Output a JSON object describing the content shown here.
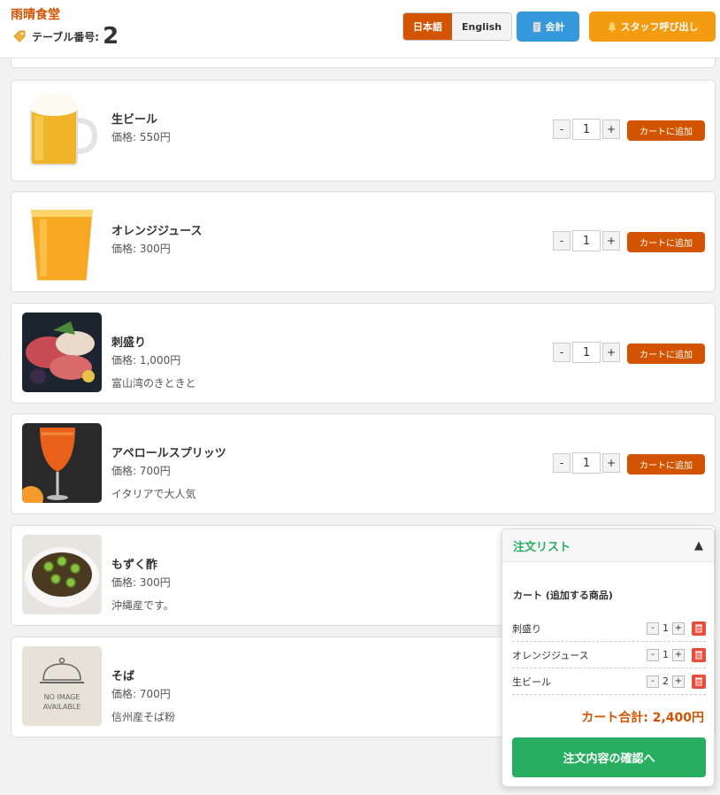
{
  "header": {
    "store_name": "雨晴食堂",
    "table_label": "テーブル番号:",
    "table_number": "2",
    "lang_ja": "日本語",
    "lang_en": "English",
    "pay_label": "会計",
    "staff_label": "スタッフ呼び出し"
  },
  "items": [
    {
      "name": "生ビール",
      "price": "価格: 550円",
      "desc": "",
      "qty": "1",
      "add_label": "カートに追加"
    },
    {
      "name": "オレンジジュース",
      "price": "価格: 300円",
      "desc": "",
      "qty": "1",
      "add_label": "カートに追加"
    },
    {
      "name": "刺盛り",
      "price": "価格: 1,000円",
      "desc": "富山湾のきときと",
      "qty": "1",
      "add_label": "カートに追加"
    },
    {
      "name": "アペロールスプリッツ",
      "price": "価格: 700円",
      "desc": "イタリアで大人気",
      "qty": "1",
      "add_label": "カートに追加"
    },
    {
      "name": "もずく酢",
      "price": "価格: 300円",
      "desc": "沖縄産です。"
    },
    {
      "name": "そば",
      "price": "価格: 700円",
      "desc": "信州産そば粉",
      "no_image_line1": "NO IMAGE",
      "no_image_line2": "AVAILABLE"
    }
  ],
  "cart": {
    "title": "注文リスト",
    "toggle": "▲",
    "subtitle": "カート (追加する商品)",
    "rows": [
      {
        "name": "刺盛り",
        "qty": "1",
        "minus": "-",
        "plus": "+"
      },
      {
        "name": "オレンジジュース",
        "qty": "1",
        "minus": "-",
        "plus": "+"
      },
      {
        "name": "生ビール",
        "qty": "2",
        "minus": "-",
        "plus": "+"
      }
    ],
    "total": "カート合計: 2,400円",
    "confirm_label": "注文内容の確認へ"
  },
  "controls": {
    "minus": "-",
    "plus": "+"
  },
  "colors": {
    "accent": "#d35400",
    "pay": "#3498db",
    "staff": "#f39c12",
    "cart_green": "#27ae60",
    "trash": "#e74c3c"
  }
}
